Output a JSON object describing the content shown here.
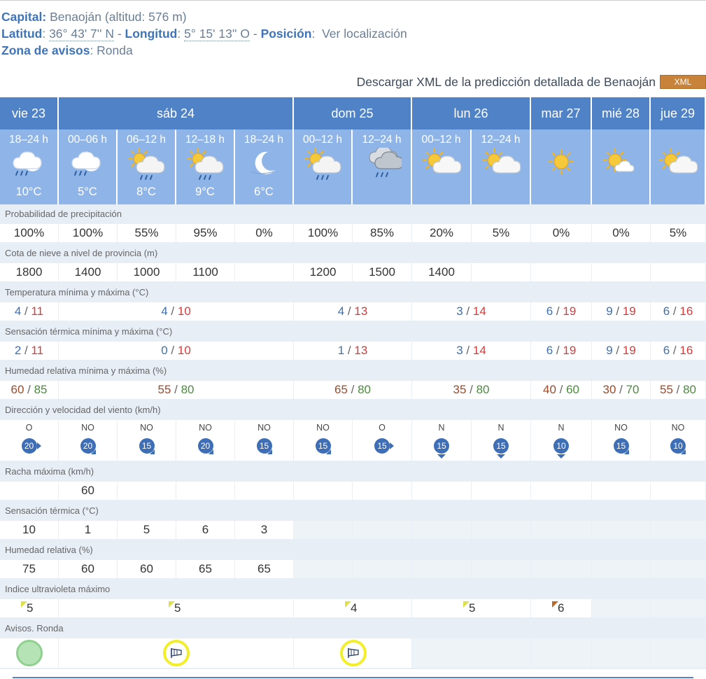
{
  "header": {
    "capital_label": "Capital:",
    "capital_value": "Benaoján (altitud: 576 m)",
    "lat_label": "Latitud",
    "lat_value": "36° 43' 7'' N",
    "sep1": " - ",
    "lon_label": "Longitud",
    "lon_value": "5° 15' 13'' O",
    "sep2": " - ",
    "pos_label": "Posición",
    "pos_link": "Ver localización",
    "zona_label": "Zona de avisos",
    "zona_value": "Ronda"
  },
  "xml": {
    "text": "Descargar XML de la predicción detallada de Benaoján",
    "button": "XML"
  },
  "days": [
    "vie 23",
    "sáb 24",
    "dom 25",
    "lun 26",
    "mar 27",
    "mié 28",
    "jue 29"
  ],
  "periods": [
    {
      "label": "18–24 h",
      "temp": "10°C",
      "icon": "rain-night-icon"
    },
    {
      "label": "00–06 h",
      "temp": "5°C",
      "icon": "rain-night-icon"
    },
    {
      "label": "06–12 h",
      "temp": "8°C",
      "icon": "sun-cloud-rain-icon"
    },
    {
      "label": "12–18 h",
      "temp": "9°C",
      "icon": "sun-cloud-rain-icon"
    },
    {
      "label": "18–24 h",
      "temp": "6°C",
      "icon": "moon-icon"
    },
    {
      "label": "00–12 h",
      "temp": "",
      "icon": "sun-cloud-rain-icon"
    },
    {
      "label": "12–24 h",
      "temp": "",
      "icon": "cloud-rain-icon"
    },
    {
      "label": "00–12 h",
      "temp": "",
      "icon": "sun-cloud-icon"
    },
    {
      "label": "12–24 h",
      "temp": "",
      "icon": "sun-cloud-icon"
    },
    {
      "label": "",
      "temp": "",
      "icon": "sun-icon"
    },
    {
      "label": "",
      "temp": "",
      "icon": "sun-cloud-small-icon"
    },
    {
      "label": "",
      "temp": "",
      "icon": "sun-cloud-icon"
    }
  ],
  "rows": {
    "precip": {
      "label": "Probabilidad de precipitación",
      "values": [
        "100%",
        "100%",
        "55%",
        "95%",
        "0%",
        "100%",
        "85%",
        "20%",
        "5%",
        "0%",
        "0%",
        "5%"
      ]
    },
    "snow": {
      "label": "Cota de nieve a nivel de provincia (m)",
      "values": [
        "1800",
        "1400",
        "1000",
        "1100",
        "",
        "1200",
        "1500",
        "1400",
        "",
        "",
        "",
        ""
      ]
    },
    "temp": {
      "label": "Temperatura mínima y máxima (°C)",
      "values": [
        [
          "4",
          "11"
        ],
        [
          "4",
          "10"
        ],
        [
          "4",
          "13"
        ],
        [
          "3",
          "14"
        ],
        [
          "6",
          "19"
        ],
        [
          "9",
          "19"
        ],
        [
          "6",
          "16"
        ]
      ]
    },
    "feels": {
      "label": "Sensación térmica mínima y máxima (°C)",
      "values": [
        [
          "2",
          "11"
        ],
        [
          "0",
          "10"
        ],
        [
          "1",
          "13"
        ],
        [
          "3",
          "14"
        ],
        [
          "6",
          "19"
        ],
        [
          "9",
          "19"
        ],
        [
          "6",
          "16"
        ]
      ]
    },
    "hum": {
      "label": "Humedad relativa mínima y máxima (%)",
      "values": [
        [
          "60",
          "85"
        ],
        [
          "55",
          "80"
        ],
        [
          "65",
          "80"
        ],
        [
          "35",
          "80"
        ],
        [
          "40",
          "60"
        ],
        [
          "30",
          "70"
        ],
        [
          "55",
          "80"
        ]
      ]
    },
    "wind": {
      "label": "Dirección y velocidad del viento (km/h)",
      "values": [
        {
          "dir": "O",
          "speed": "20"
        },
        {
          "dir": "NO",
          "speed": "20"
        },
        {
          "dir": "NO",
          "speed": "15"
        },
        {
          "dir": "NO",
          "speed": "20"
        },
        {
          "dir": "NO",
          "speed": "15"
        },
        {
          "dir": "NO",
          "speed": "15"
        },
        {
          "dir": "O",
          "speed": "15"
        },
        {
          "dir": "N",
          "speed": "15"
        },
        {
          "dir": "N",
          "speed": "15"
        },
        {
          "dir": "N",
          "speed": "10"
        },
        {
          "dir": "NO",
          "speed": "15"
        },
        {
          "dir": "NO",
          "speed": "10"
        }
      ]
    },
    "gust": {
      "label": "Racha máxima (km/h)",
      "values": [
        "",
        "60",
        "",
        "",
        "",
        "",
        "",
        "",
        "",
        "",
        "",
        ""
      ]
    },
    "feels_h": {
      "label": "Sensación térmica (°C)",
      "values": [
        "10",
        "1",
        "5",
        "6",
        "3"
      ]
    },
    "hum_h": {
      "label": "Humedad relativa (%)",
      "values": [
        "75",
        "60",
        "60",
        "65",
        "65"
      ]
    },
    "uv": {
      "label": "Indice ultravioleta máximo",
      "values": [
        "5",
        "5",
        "4",
        "5",
        "6"
      ]
    },
    "avisos": {
      "label": "Avisos. Ronda"
    }
  },
  "colors": {
    "header_blue": "#4f82c6",
    "icon_bg": "#8fb5e8",
    "label_bg": "#e7eef5",
    "min_blue": "#3d6fb1",
    "max_red": "#d63a3a",
    "warn_green": "#b6e3b6",
    "warn_yellow": "#f2ee2a",
    "xml_orange": "#c9823a"
  }
}
